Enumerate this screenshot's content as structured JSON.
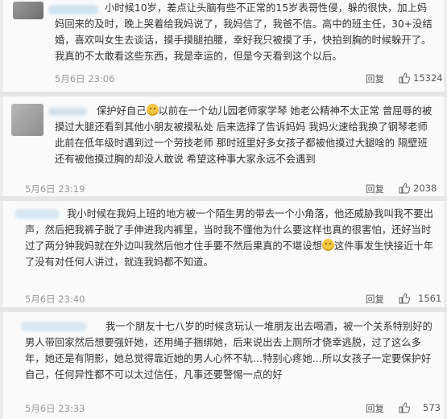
{
  "comments": [
    {
      "text": "小时候10岁，差点让头脑有些不正常的15岁表哥性侵，躲的很快，加上妈妈回来的及时，晚上哭着给我妈说了，我妈信了，我爸不信。高中的班主任，30+没结婚，喜欢叫女生去谈话，摸手摸腿拍腰，幸好我只被摸了手，快拍到胸的时候躲开了。我真的不太敢看这些东西，我是幸运的，但是今天看到这个以后。",
      "time": "5月6日 23:06",
      "reply": "回复",
      "likes": "15324"
    },
    {
      "text_before": "保护好自己",
      "text_after": "以前在一个幼儿园老师家学琴 她老公精神不太正常 曾屈辱的被摸过大腿还看到其他小朋友被摸私处 后来选择了告诉妈妈 我妈火速给我换了钢琴老师 此前在低年级时遇到过一个劳技老师 那时班里好多女孩子都被他摸过大腿啥的 隔壁班还有被他摸过胸的却没人敢说 希望这种事大家永远不会遇到",
      "time": "5月6日 23:19",
      "reply": "回复",
      "likes": "2038"
    },
    {
      "text_before": "我小时候在我妈上班的地方被一个陌生男的带去一个小角落，他还威胁我叫我不要出声，然后把我裤子脱了手伸进我内裤里，当时我不懂他为什么要这样也真的很害怕，还好当时过了两分钟我妈就在外边叫我然后他才住手要不然后果真的不堪设想",
      "text_after": "这件事发生快接近十年了没有对任何人讲过，就连我妈都不知道。",
      "time": "5月6日 23:40",
      "reply": "回复",
      "likes": "1561"
    },
    {
      "text": "我一个朋友十七八岁的时候贪玩认一堆朋友出去喝酒，被一个关系特别好的男人带回家然后想要强奸她，还用绳子捆绑她，后来说出去上厕所才侥幸逃脱，过了这么多年，她还是有阴影，她总觉得靠近她的男人心怀不轨…特别心疼她…所以女孩子一定要保护好自己，任何异性都不可以太过信任，凡事还要警惕一点的好",
      "time": "5月6日 23:33",
      "reply": "回复",
      "likes": "573"
    }
  ]
}
